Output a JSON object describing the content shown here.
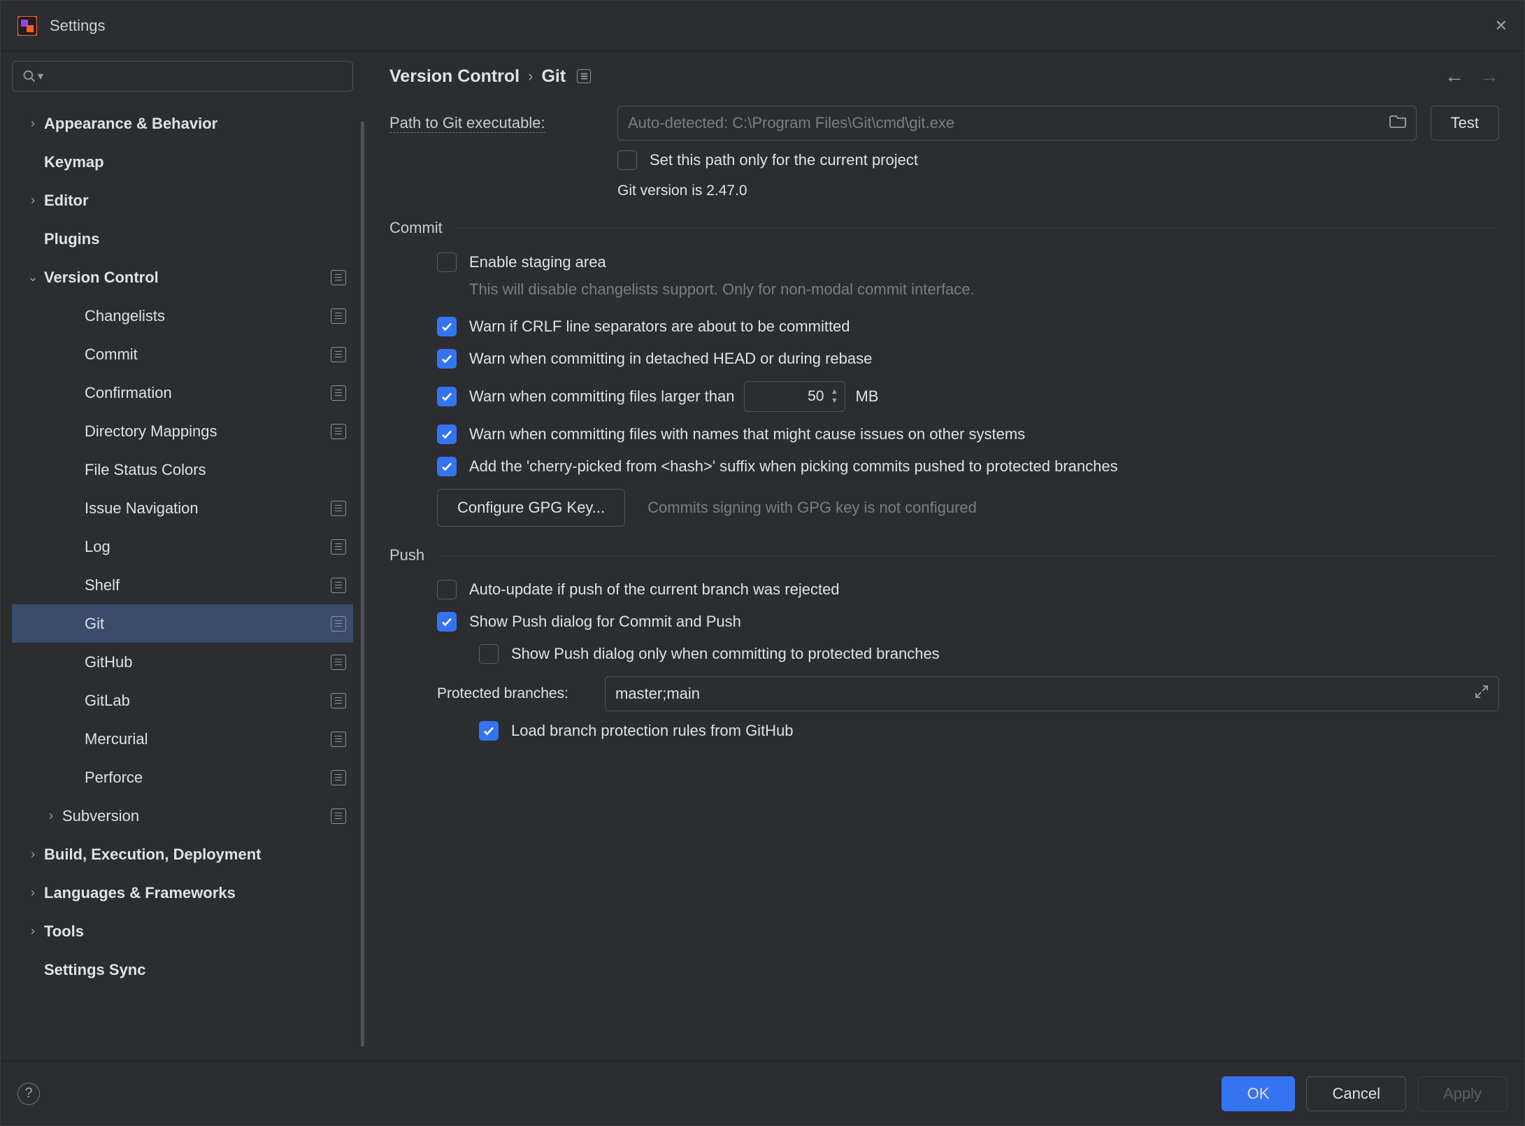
{
  "window": {
    "title": "Settings"
  },
  "search": {
    "placeholder": ""
  },
  "sidebar": {
    "items": [
      {
        "label": "Appearance & Behavior",
        "expandable": true,
        "bold": true
      },
      {
        "label": "Keymap",
        "bold": true
      },
      {
        "label": "Editor",
        "expandable": true,
        "bold": true
      },
      {
        "label": "Plugins",
        "bold": true
      },
      {
        "label": "Version Control",
        "expandable": true,
        "expanded": true,
        "bold": true,
        "scope": true,
        "children": [
          {
            "label": "Changelists",
            "scope": true
          },
          {
            "label": "Commit",
            "scope": true
          },
          {
            "label": "Confirmation",
            "scope": true
          },
          {
            "label": "Directory Mappings",
            "scope": true
          },
          {
            "label": "File Status Colors"
          },
          {
            "label": "Issue Navigation",
            "scope": true
          },
          {
            "label": "Log",
            "scope": true
          },
          {
            "label": "Shelf",
            "scope": true
          },
          {
            "label": "Git",
            "scope": true,
            "selected": true
          },
          {
            "label": "GitHub",
            "scope": true
          },
          {
            "label": "GitLab",
            "scope": true
          },
          {
            "label": "Mercurial",
            "scope": true
          },
          {
            "label": "Perforce",
            "scope": true
          },
          {
            "label": "Subversion",
            "expandable": true,
            "scope": true
          }
        ]
      },
      {
        "label": "Build, Execution, Deployment",
        "expandable": true,
        "bold": true
      },
      {
        "label": "Languages & Frameworks",
        "expandable": true,
        "bold": true
      },
      {
        "label": "Tools",
        "expandable": true,
        "bold": true
      },
      {
        "label": "Settings Sync",
        "bold": true
      }
    ]
  },
  "breadcrumb": {
    "parent": "Version Control",
    "current": "Git"
  },
  "git": {
    "path_label": "Path to Git executable:",
    "path_placeholder": "Auto-detected: C:\\Program Files\\Git\\cmd\\git.exe",
    "test_button": "Test",
    "path_project_only": "Set this path only for the current project",
    "version_text": "Git version is 2.47.0",
    "commit_section": "Commit",
    "enable_staging": "Enable staging area",
    "staging_hint": "This will disable changelists support. Only for non-modal commit interface.",
    "warn_crlf": "Warn if CRLF line separators are about to be committed",
    "warn_detached": "Warn when committing in detached HEAD or during rebase",
    "warn_large": "Warn when committing files larger than",
    "large_size": "50",
    "large_unit": "MB",
    "warn_names": "Warn when committing files with names that might cause issues on other systems",
    "cherry_suffix": "Add the 'cherry-picked from <hash>' suffix when picking commits pushed to protected branches",
    "gpg_button": "Configure GPG Key...",
    "gpg_hint": "Commits signing with GPG key is not configured",
    "push_section": "Push",
    "auto_update": "Auto-update if push of the current branch was rejected",
    "show_push": "Show Push dialog for Commit and Push",
    "show_push_protected": "Show Push dialog only when committing to protected branches",
    "protected_label": "Protected branches:",
    "protected_value": "master;main",
    "load_rules": "Load branch protection rules from GitHub"
  },
  "footer": {
    "ok": "OK",
    "cancel": "Cancel",
    "apply": "Apply"
  }
}
